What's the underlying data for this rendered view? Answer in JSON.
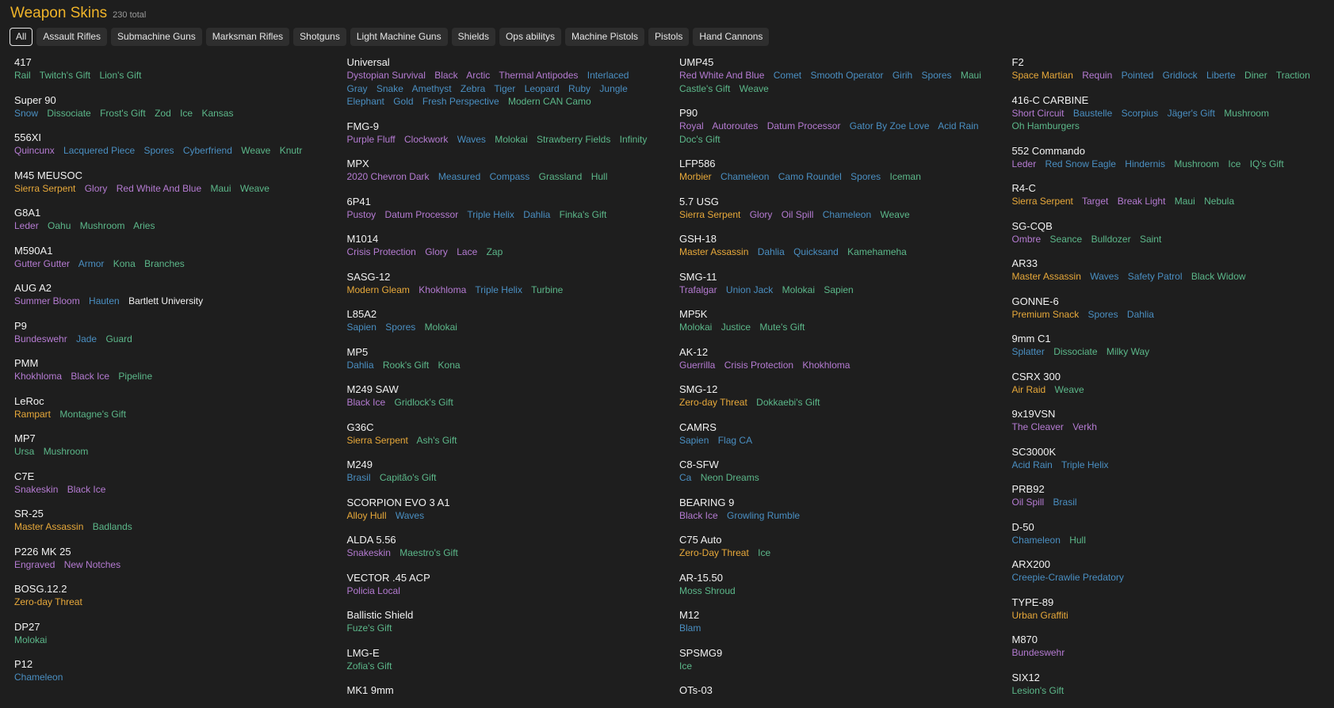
{
  "header": {
    "title": "Weapon Skins",
    "count": "230 total"
  },
  "tabs": [
    "All",
    "Assault Rifles",
    "Submachine Guns",
    "Marksman Rifles",
    "Shotguns",
    "Light Machine Guns",
    "Shields",
    "Ops abilitys",
    "Machine Pistols",
    "Pistols",
    "Hand Cannons"
  ],
  "active_tab": "All",
  "rarity_colors": {
    "o": "#e8a93a",
    "p": "#b57bd2",
    "b": "#4a8fc2",
    "g": "#5cb88a",
    "w": "#f2f2f2"
  },
  "columns": [
    [
      {
        "name": "417",
        "skins": [
          [
            "Rail",
            "g"
          ],
          [
            "Twitch's Gift",
            "g"
          ],
          [
            "Lion's Gift",
            "g"
          ]
        ]
      },
      {
        "name": "Super 90",
        "skins": [
          [
            "Snow",
            "b"
          ],
          [
            "Dissociate",
            "g"
          ],
          [
            "Frost's Gift",
            "g"
          ],
          [
            "Zod",
            "g"
          ],
          [
            "Ice",
            "g"
          ],
          [
            "Kansas",
            "g"
          ]
        ]
      },
      {
        "name": "556XI",
        "skins": [
          [
            "Quincunx",
            "p"
          ],
          [
            "Lacquered Piece",
            "b"
          ],
          [
            "Spores",
            "b"
          ],
          [
            "Cyberfriend",
            "b"
          ],
          [
            "Weave",
            "g"
          ],
          [
            "Knutr",
            "g"
          ]
        ]
      },
      {
        "name": "M45 MEUSOC",
        "skins": [
          [
            "Sierra Serpent",
            "o"
          ],
          [
            "Glory",
            "p"
          ],
          [
            "Red White And Blue",
            "p"
          ],
          [
            "Maui",
            "g"
          ],
          [
            "Weave",
            "g"
          ]
        ]
      },
      {
        "name": "G8A1",
        "skins": [
          [
            "Leder",
            "p"
          ],
          [
            "Oahu",
            "g"
          ],
          [
            "Mushroom",
            "g"
          ],
          [
            "Aries",
            "g"
          ]
        ]
      },
      {
        "name": "M590A1",
        "skins": [
          [
            "Gutter Gutter",
            "p"
          ],
          [
            "Armor",
            "b"
          ],
          [
            "Kona",
            "g"
          ],
          [
            "Branches",
            "g"
          ]
        ]
      },
      {
        "name": "AUG A2",
        "skins": [
          [
            "Summer Bloom",
            "p"
          ],
          [
            "Hauten",
            "b"
          ],
          [
            "Bartlett University",
            "w"
          ]
        ]
      },
      {
        "name": "P9",
        "skins": [
          [
            "Bundeswehr",
            "p"
          ],
          [
            "Jade",
            "b"
          ],
          [
            "Guard",
            "g"
          ]
        ]
      },
      {
        "name": "PMM",
        "skins": [
          [
            "Khokhloma",
            "p"
          ],
          [
            "Black Ice",
            "p"
          ],
          [
            "Pipeline",
            "g"
          ]
        ]
      },
      {
        "name": "LeRoc",
        "skins": [
          [
            "Rampart",
            "o"
          ],
          [
            "Montagne's Gift",
            "g"
          ]
        ]
      },
      {
        "name": "MP7",
        "skins": [
          [
            "Ursa",
            "g"
          ],
          [
            "Mushroom",
            "g"
          ]
        ]
      },
      {
        "name": "C7E",
        "skins": [
          [
            "Snakeskin",
            "p"
          ],
          [
            "Black Ice",
            "p"
          ]
        ]
      },
      {
        "name": "SR-25",
        "skins": [
          [
            "Master Assassin",
            "o"
          ],
          [
            "Badlands",
            "g"
          ]
        ]
      },
      {
        "name": "P226 MK 25",
        "skins": [
          [
            "Engraved",
            "p"
          ],
          [
            "New Notches",
            "p"
          ]
        ]
      },
      {
        "name": "BOSG.12.2",
        "skins": [
          [
            "Zero-day Threat",
            "o"
          ]
        ]
      },
      {
        "name": "DP27",
        "skins": [
          [
            "Molokai",
            "g"
          ]
        ]
      },
      {
        "name": "P12",
        "skins": [
          [
            "Chameleon",
            "b"
          ]
        ]
      }
    ],
    [
      {
        "name": "Universal",
        "skins": [
          [
            "Dystopian Survival",
            "p"
          ],
          [
            "Black",
            "p"
          ],
          [
            "Arctic",
            "p"
          ],
          [
            "Thermal Antipodes",
            "p"
          ],
          [
            "Interlaced",
            "b"
          ],
          [
            "Gray",
            "b"
          ],
          [
            "Snake",
            "b"
          ],
          [
            "Amethyst",
            "b"
          ],
          [
            "Zebra",
            "b"
          ],
          [
            "Tiger",
            "b"
          ],
          [
            "Leopard",
            "b"
          ],
          [
            "Ruby",
            "b"
          ],
          [
            "Jungle",
            "b"
          ],
          [
            "Elephant",
            "b"
          ],
          [
            "Gold",
            "b"
          ],
          [
            "Fresh Perspective",
            "b"
          ],
          [
            "Modern CAN Camo",
            "g"
          ]
        ]
      },
      {
        "name": "FMG-9",
        "skins": [
          [
            "Purple Fluff",
            "p"
          ],
          [
            "Clockwork",
            "p"
          ],
          [
            "Waves",
            "b"
          ],
          [
            "Molokai",
            "g"
          ],
          [
            "Strawberry Fields",
            "g"
          ],
          [
            "Infinity",
            "g"
          ]
        ]
      },
      {
        "name": "MPX",
        "skins": [
          [
            "2020 Chevron Dark",
            "p"
          ],
          [
            "Measured",
            "b"
          ],
          [
            "Compass",
            "b"
          ],
          [
            "Grassland",
            "g"
          ],
          [
            "Hull",
            "g"
          ]
        ]
      },
      {
        "name": "6P41",
        "skins": [
          [
            "Pustoy",
            "p"
          ],
          [
            "Datum Processor",
            "p"
          ],
          [
            "Triple Helix",
            "b"
          ],
          [
            "Dahlia",
            "b"
          ],
          [
            "Finka's Gift",
            "g"
          ]
        ]
      },
      {
        "name": "M1014",
        "skins": [
          [
            "Crisis Protection",
            "p"
          ],
          [
            "Glory",
            "p"
          ],
          [
            "Lace",
            "p"
          ],
          [
            "Zap",
            "g"
          ]
        ]
      },
      {
        "name": "SASG-12",
        "skins": [
          [
            "Modern Gleam",
            "o"
          ],
          [
            "Khokhloma",
            "p"
          ],
          [
            "Triple Helix",
            "b"
          ],
          [
            "Turbine",
            "g"
          ]
        ]
      },
      {
        "name": "L85A2",
        "skins": [
          [
            "Sapien",
            "b"
          ],
          [
            "Spores",
            "b"
          ],
          [
            "Molokai",
            "g"
          ]
        ]
      },
      {
        "name": "MP5",
        "skins": [
          [
            "Dahlia",
            "b"
          ],
          [
            "Rook's Gift",
            "g"
          ],
          [
            "Kona",
            "g"
          ]
        ]
      },
      {
        "name": "M249 SAW",
        "skins": [
          [
            "Black Ice",
            "p"
          ],
          [
            "Gridlock's Gift",
            "g"
          ]
        ]
      },
      {
        "name": "G36C",
        "skins": [
          [
            "Sierra Serpent",
            "o"
          ],
          [
            "Ash's Gift",
            "g"
          ]
        ]
      },
      {
        "name": "M249",
        "skins": [
          [
            "Brasil",
            "b"
          ],
          [
            "Capitão's Gift",
            "g"
          ]
        ]
      },
      {
        "name": "SCORPION EVO 3 A1",
        "skins": [
          [
            "Alloy Hull",
            "o"
          ],
          [
            "Waves",
            "b"
          ]
        ]
      },
      {
        "name": "ALDA 5.56",
        "skins": [
          [
            "Snakeskin",
            "p"
          ],
          [
            "Maestro's Gift",
            "g"
          ]
        ]
      },
      {
        "name": "VECTOR .45 ACP",
        "skins": [
          [
            "Policia Local",
            "p"
          ]
        ]
      },
      {
        "name": "Ballistic Shield",
        "skins": [
          [
            "Fuze's Gift",
            "g"
          ]
        ]
      },
      {
        "name": "LMG-E",
        "skins": [
          [
            "Zofia's Gift",
            "g"
          ]
        ]
      },
      {
        "name": "MK1 9mm",
        "skins": []
      }
    ],
    [
      {
        "name": "UMP45",
        "skins": [
          [
            "Red White And Blue",
            "p"
          ],
          [
            "Comet",
            "b"
          ],
          [
            "Smooth Operator",
            "b"
          ],
          [
            "Girih",
            "b"
          ],
          [
            "Spores",
            "b"
          ],
          [
            "Maui",
            "g"
          ],
          [
            "Castle's Gift",
            "g"
          ],
          [
            "Weave",
            "g"
          ]
        ]
      },
      {
        "name": "P90",
        "skins": [
          [
            "Royal",
            "p"
          ],
          [
            "Autoroutes",
            "p"
          ],
          [
            "Datum Processor",
            "p"
          ],
          [
            "Gator By Zoe Love",
            "b"
          ],
          [
            "Acid Rain",
            "b"
          ],
          [
            "Doc's Gift",
            "g"
          ]
        ]
      },
      {
        "name": "LFP586",
        "skins": [
          [
            "Morbier",
            "o"
          ],
          [
            "Chameleon",
            "b"
          ],
          [
            "Camo Roundel",
            "b"
          ],
          [
            "Spores",
            "b"
          ],
          [
            "Iceman",
            "g"
          ]
        ]
      },
      {
        "name": "5.7 USG",
        "skins": [
          [
            "Sierra Serpent",
            "o"
          ],
          [
            "Glory",
            "p"
          ],
          [
            "Oil Spill",
            "p"
          ],
          [
            "Chameleon",
            "b"
          ],
          [
            "Weave",
            "g"
          ]
        ]
      },
      {
        "name": "GSH-18",
        "skins": [
          [
            "Master Assassin",
            "o"
          ],
          [
            "Dahlia",
            "b"
          ],
          [
            "Quicksand",
            "b"
          ],
          [
            "Kamehameha",
            "g"
          ]
        ]
      },
      {
        "name": "SMG-11",
        "skins": [
          [
            "Trafalgar",
            "p"
          ],
          [
            "Union Jack",
            "b"
          ],
          [
            "Molokai",
            "g"
          ],
          [
            "Sapien",
            "g"
          ]
        ]
      },
      {
        "name": "MP5K",
        "skins": [
          [
            "Molokai",
            "g"
          ],
          [
            "Justice",
            "g"
          ],
          [
            "Mute's Gift",
            "g"
          ]
        ]
      },
      {
        "name": "AK-12",
        "skins": [
          [
            "Guerrilla",
            "p"
          ],
          [
            "Crisis Protection",
            "p"
          ],
          [
            "Khokhloma",
            "p"
          ]
        ]
      },
      {
        "name": "SMG-12",
        "skins": [
          [
            "Zero-day Threat",
            "o"
          ],
          [
            "Dokkaebi's Gift",
            "g"
          ]
        ]
      },
      {
        "name": "CAMRS",
        "skins": [
          [
            "Sapien",
            "b"
          ],
          [
            "Flag CA",
            "b"
          ]
        ]
      },
      {
        "name": "C8-SFW",
        "skins": [
          [
            "Ca",
            "b"
          ],
          [
            "Neon Dreams",
            "g"
          ]
        ]
      },
      {
        "name": "BEARING 9",
        "skins": [
          [
            "Black Ice",
            "p"
          ],
          [
            "Growling Rumble",
            "b"
          ]
        ]
      },
      {
        "name": "C75 Auto",
        "skins": [
          [
            "Zero-Day Threat",
            "o"
          ],
          [
            "Ice",
            "g"
          ]
        ]
      },
      {
        "name": "AR-15.50",
        "skins": [
          [
            "Moss Shroud",
            "g"
          ]
        ]
      },
      {
        "name": "M12",
        "skins": [
          [
            "Blam",
            "b"
          ]
        ]
      },
      {
        "name": "SPSMG9",
        "skins": [
          [
            "Ice",
            "g"
          ]
        ]
      },
      {
        "name": "OTs-03",
        "skins": []
      }
    ],
    [
      {
        "name": "F2",
        "skins": [
          [
            "Space Martian",
            "o"
          ],
          [
            "Requin",
            "p"
          ],
          [
            "Pointed",
            "b"
          ],
          [
            "Gridlock",
            "b"
          ],
          [
            "Liberte",
            "b"
          ],
          [
            "Diner",
            "g"
          ],
          [
            "Traction",
            "g"
          ]
        ]
      },
      {
        "name": "416-C CARBINE",
        "skins": [
          [
            "Short Circuit",
            "p"
          ],
          [
            "Baustelle",
            "b"
          ],
          [
            "Scorpius",
            "b"
          ],
          [
            "Jäger's Gift",
            "b"
          ],
          [
            "Mushroom",
            "g"
          ],
          [
            "Oh Hamburgers",
            "g"
          ]
        ]
      },
      {
        "name": "552 Commando",
        "skins": [
          [
            "Leder",
            "p"
          ],
          [
            "Red Snow Eagle",
            "b"
          ],
          [
            "Hindernis",
            "b"
          ],
          [
            "Mushroom",
            "g"
          ],
          [
            "Ice",
            "g"
          ],
          [
            "IQ's Gift",
            "g"
          ]
        ]
      },
      {
        "name": "R4-C",
        "skins": [
          [
            "Sierra Serpent",
            "o"
          ],
          [
            "Target",
            "p"
          ],
          [
            "Break Light",
            "p"
          ],
          [
            "Maui",
            "g"
          ],
          [
            "Nebula",
            "g"
          ]
        ]
      },
      {
        "name": "SG-CQB",
        "skins": [
          [
            "Ombre",
            "p"
          ],
          [
            "Seance",
            "g"
          ],
          [
            "Bulldozer",
            "g"
          ],
          [
            "Saint",
            "g"
          ]
        ]
      },
      {
        "name": "AR33",
        "skins": [
          [
            "Master Assassin",
            "o"
          ],
          [
            "Waves",
            "b"
          ],
          [
            "Safety Patrol",
            "b"
          ],
          [
            "Black Widow",
            "g"
          ]
        ]
      },
      {
        "name": "GONNE-6",
        "skins": [
          [
            "Premium Snack",
            "o"
          ],
          [
            "Spores",
            "b"
          ],
          [
            "Dahlia",
            "b"
          ]
        ]
      },
      {
        "name": "9mm C1",
        "skins": [
          [
            "Splatter",
            "b"
          ],
          [
            "Dissociate",
            "g"
          ],
          [
            "Milky Way",
            "g"
          ]
        ]
      },
      {
        "name": "CSRX 300",
        "skins": [
          [
            "Air Raid",
            "o"
          ],
          [
            "Weave",
            "g"
          ]
        ]
      },
      {
        "name": "9x19VSN",
        "skins": [
          [
            "The Cleaver",
            "p"
          ],
          [
            "Verkh",
            "p"
          ]
        ]
      },
      {
        "name": "SC3000K",
        "skins": [
          [
            "Acid Rain",
            "b"
          ],
          [
            "Triple Helix",
            "b"
          ]
        ]
      },
      {
        "name": "PRB92",
        "skins": [
          [
            "Oil Spill",
            "p"
          ],
          [
            "Brasil",
            "b"
          ]
        ]
      },
      {
        "name": "D-50",
        "skins": [
          [
            "Chameleon",
            "b"
          ],
          [
            "Hull",
            "g"
          ]
        ]
      },
      {
        "name": "ARX200",
        "skins": [
          [
            "Creepie-Crawlie Predatory",
            "b"
          ]
        ]
      },
      {
        "name": "TYPE-89",
        "skins": [
          [
            "Urban Graffiti",
            "o"
          ]
        ]
      },
      {
        "name": "M870",
        "skins": [
          [
            "Bundeswehr",
            "p"
          ]
        ]
      },
      {
        "name": "SIX12",
        "skins": [
          [
            "Lesion's Gift",
            "g"
          ]
        ]
      }
    ]
  ]
}
